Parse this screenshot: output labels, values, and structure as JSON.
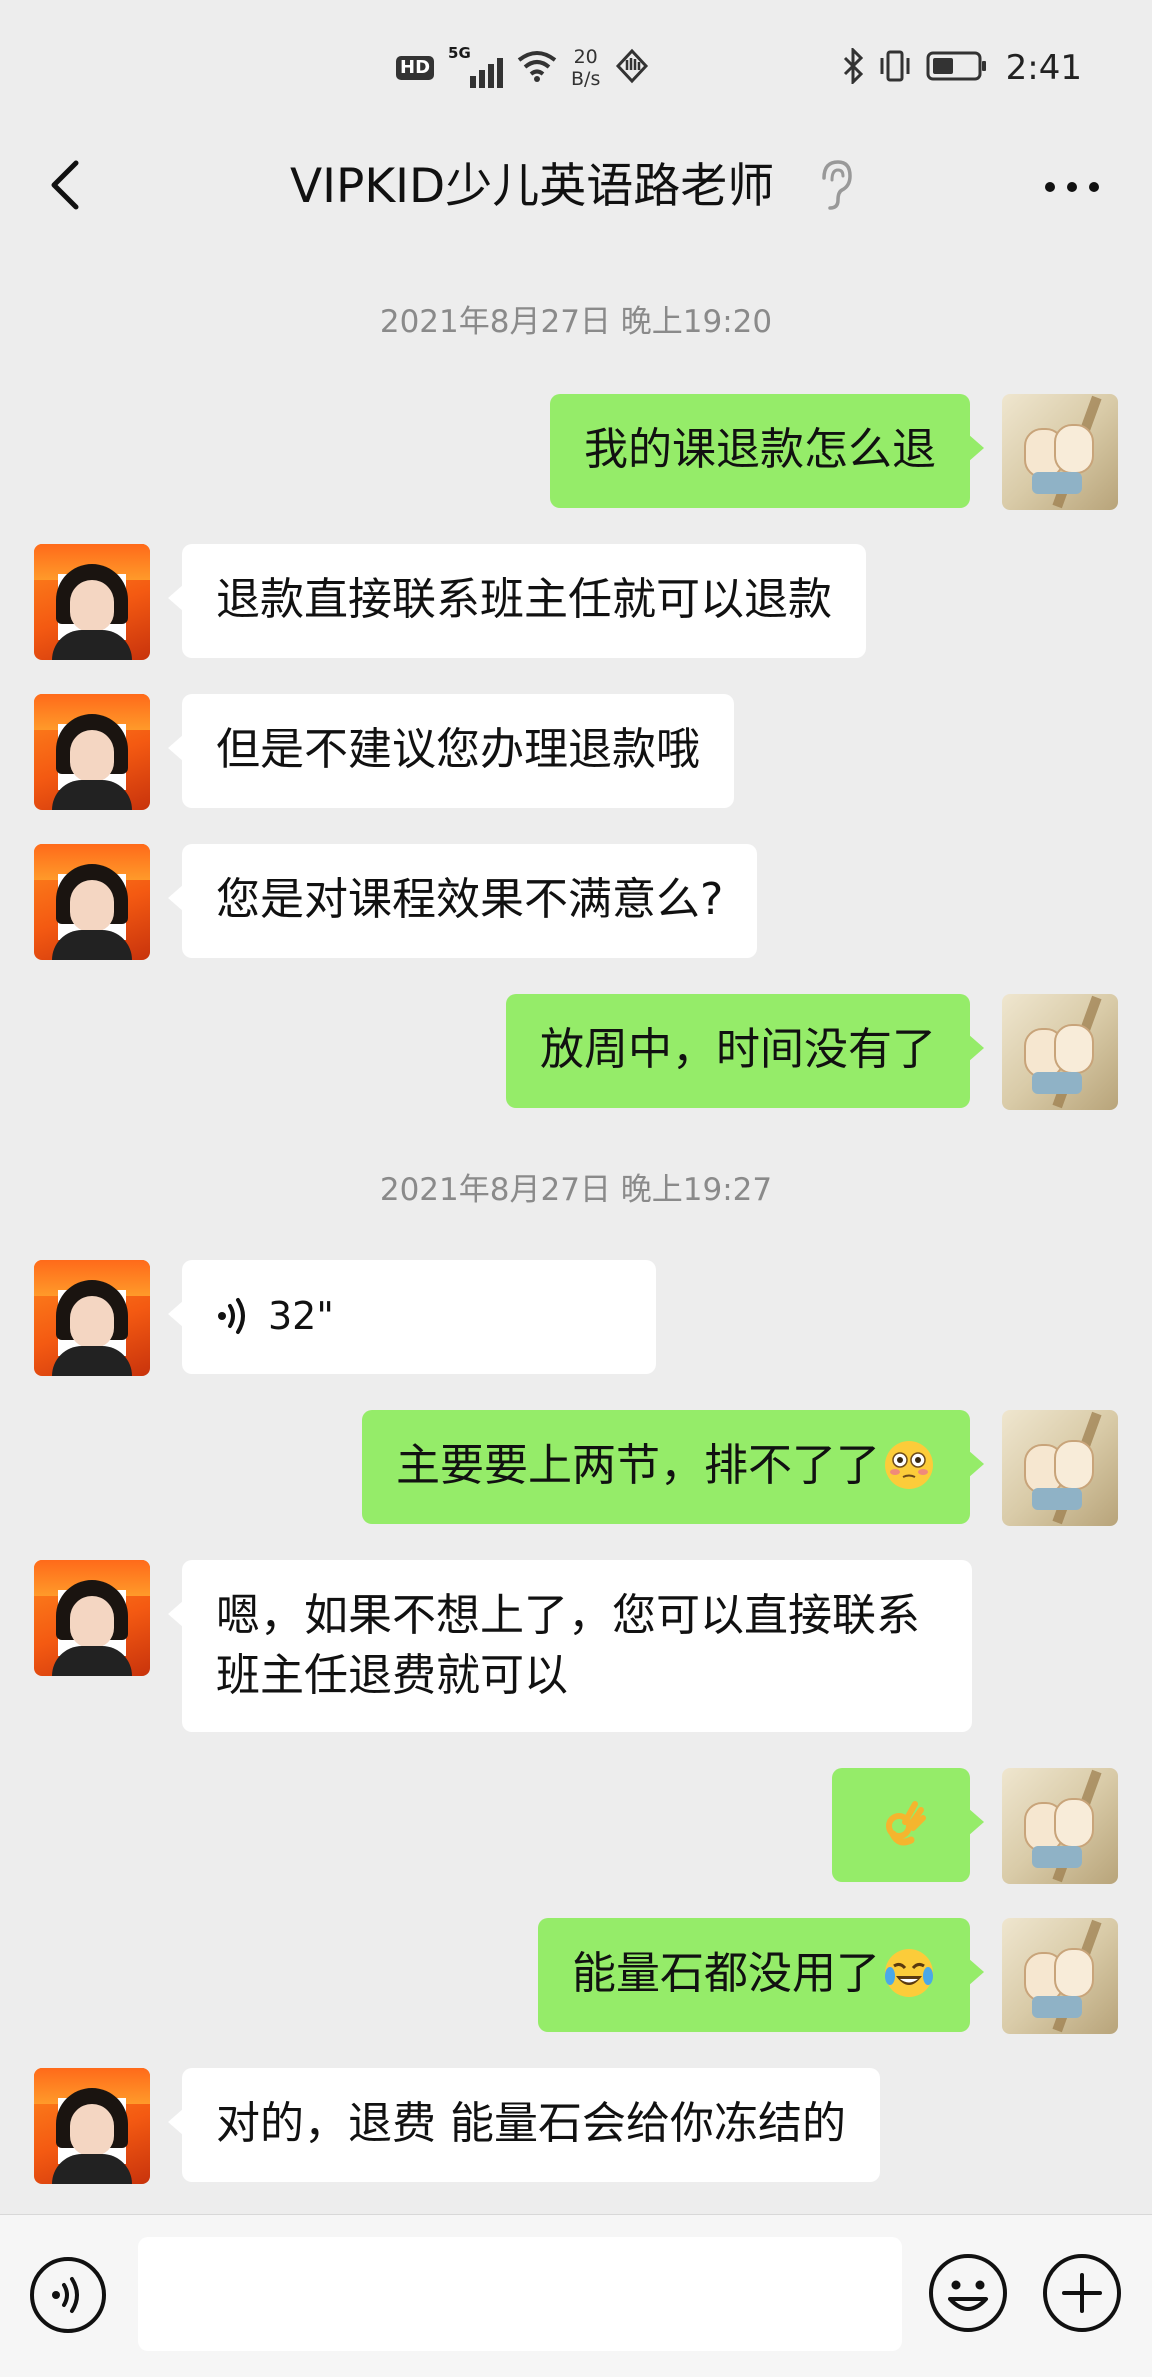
{
  "status_bar": {
    "hd": "HD",
    "network": "5G",
    "speed_value": "20",
    "speed_unit": "B/s",
    "time": "2:41"
  },
  "header": {
    "title": "VIPKID少儿英语路老师"
  },
  "messages": [
    {
      "type": "time",
      "text": "2021年8月27日 晚上19:20"
    },
    {
      "type": "out",
      "text": "我的课退款怎么退"
    },
    {
      "type": "in",
      "text": "退款直接联系班主任就可以退款"
    },
    {
      "type": "in",
      "text": "但是不建议您办理退款哦"
    },
    {
      "type": "in",
      "text": "您是对课程效果不满意么?"
    },
    {
      "type": "out",
      "text": "放周中，时间没有了"
    },
    {
      "type": "time",
      "text": "2021年8月27日 晚上19:27"
    },
    {
      "type": "in_voice",
      "duration": "32\""
    },
    {
      "type": "out",
      "text": "主要要上两节，排不了了",
      "emoji": "flushed-face-emoji"
    },
    {
      "type": "in",
      "text": "嗯，如果不想上了，您可以直接联系班主任退费就可以"
    },
    {
      "type": "out",
      "text": "",
      "emoji": "ok-hand-emoji"
    },
    {
      "type": "out",
      "text": "能量石都没用了",
      "emoji": "crying-laughing-emoji"
    },
    {
      "type": "in",
      "text": "对的，退费 能量石会给你冻结的"
    }
  ],
  "input_bar": {
    "placeholder": ""
  },
  "colors": {
    "background": "#ededed",
    "outgoing_bubble": "#95ec69",
    "incoming_bubble": "#ffffff"
  }
}
